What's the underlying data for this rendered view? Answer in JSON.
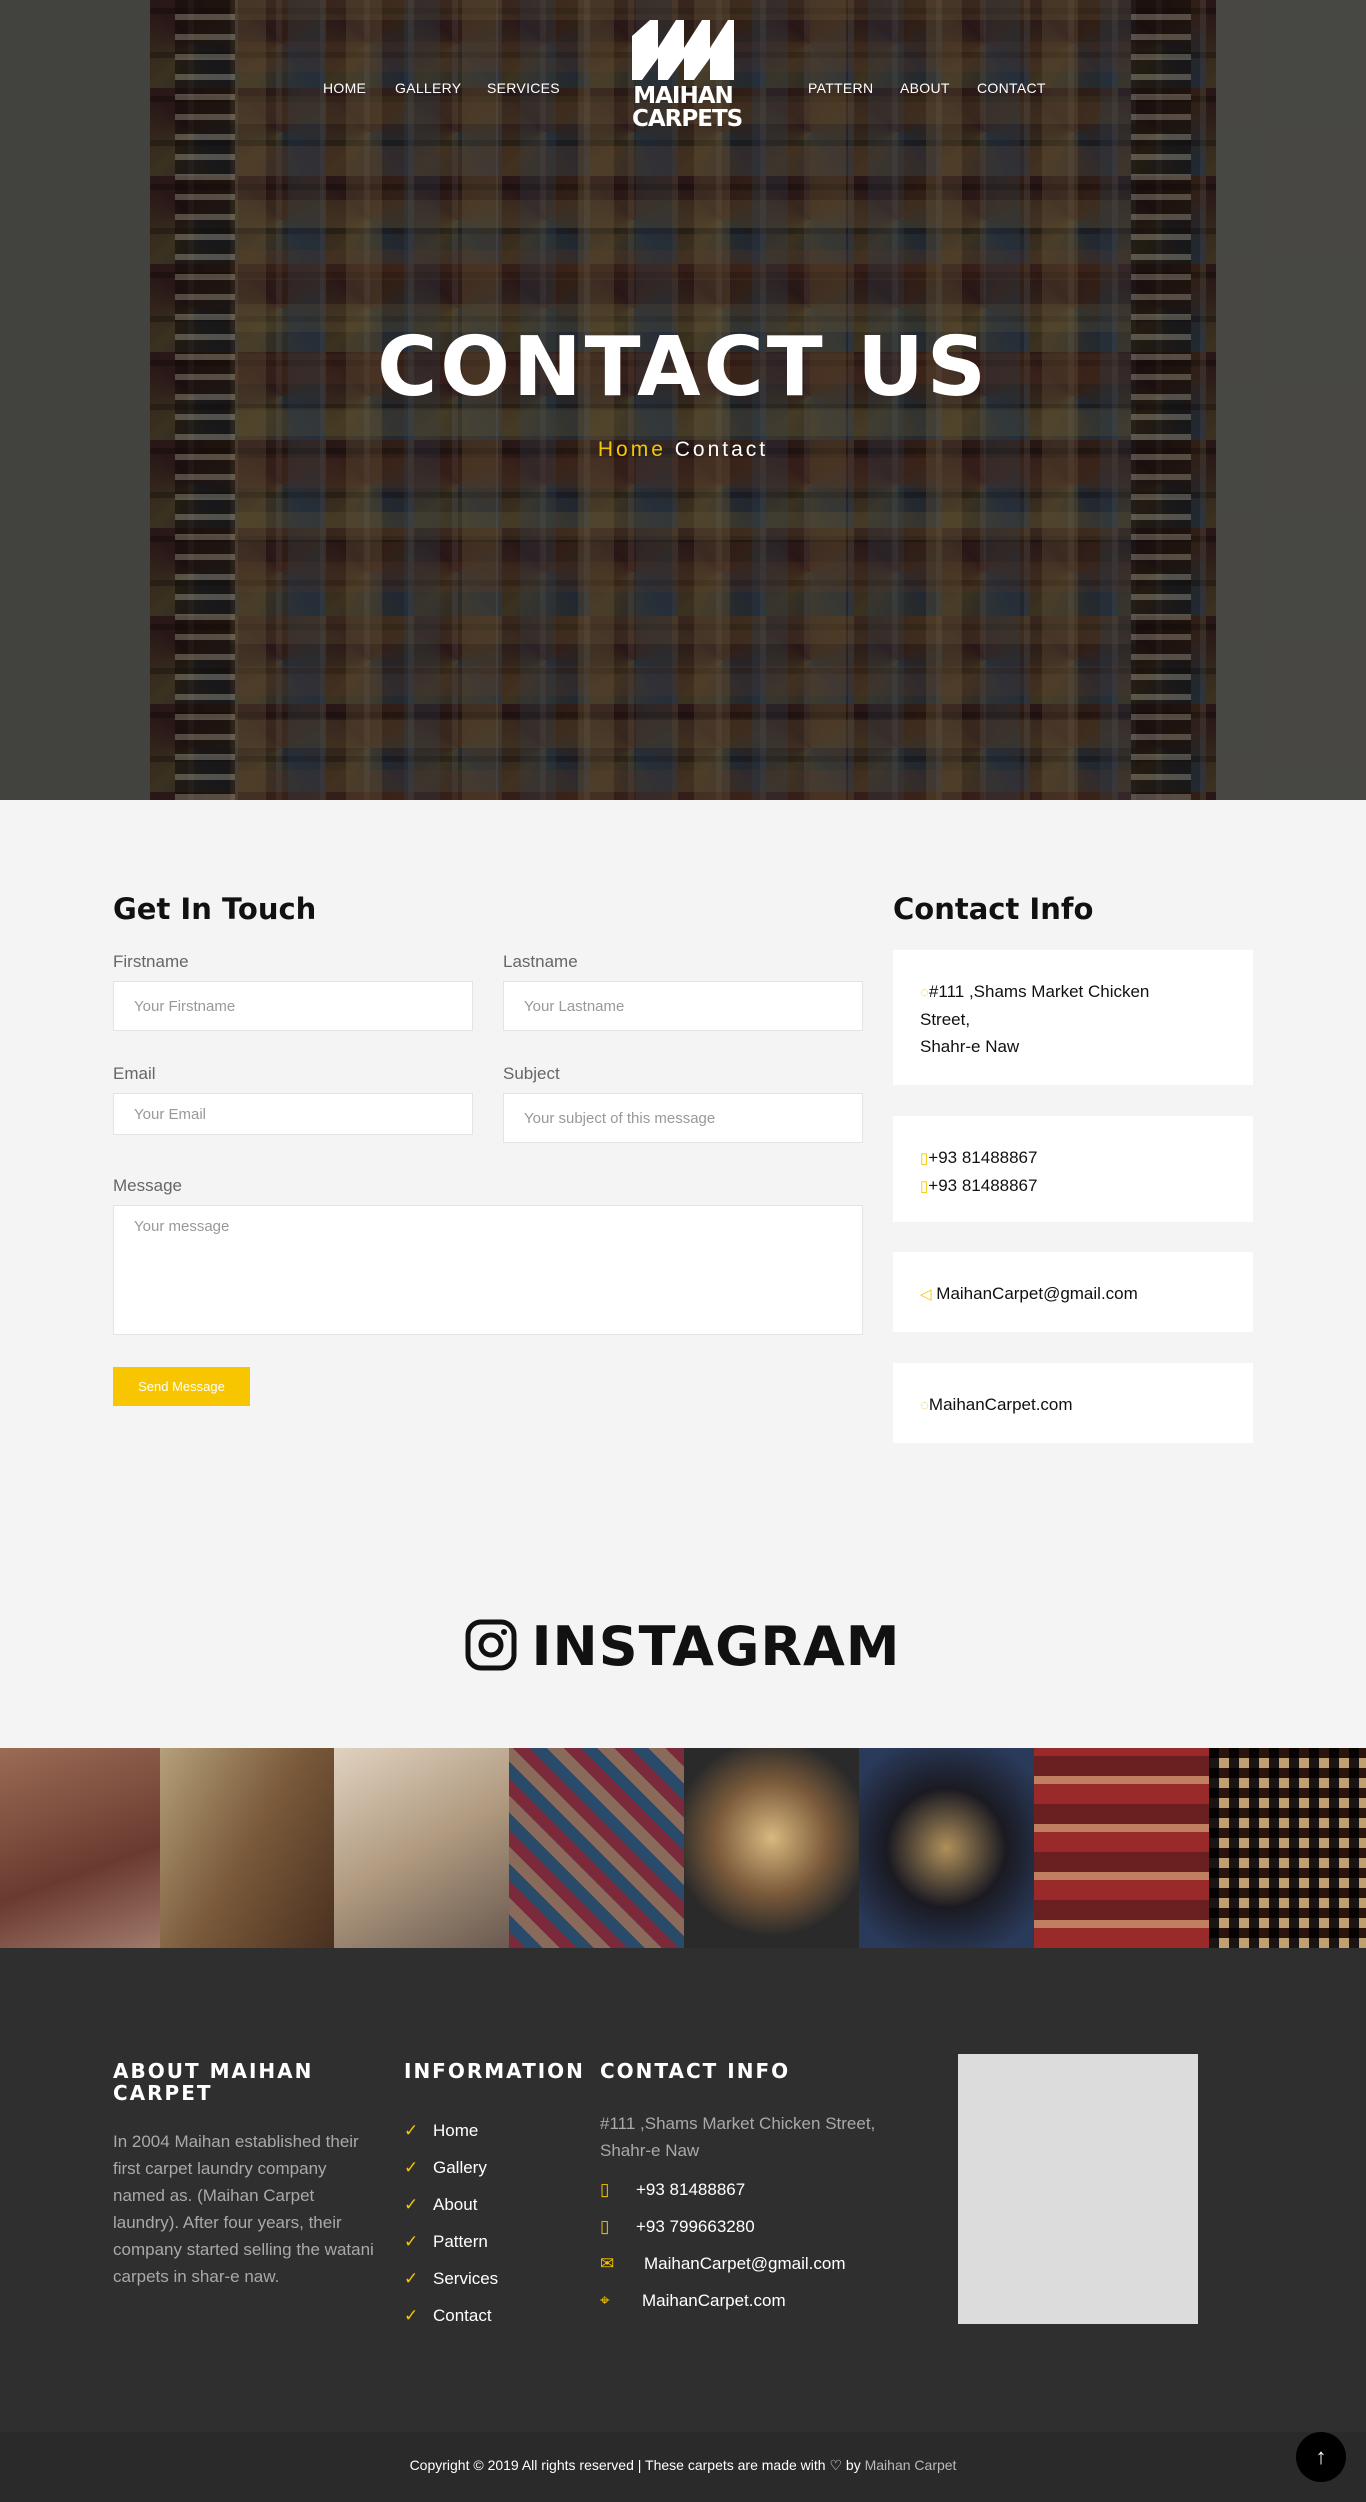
{
  "nav": {
    "left": [
      "HOME",
      "GALLERY",
      "SERVICES"
    ],
    "right": [
      "PATTERN",
      "ABOUT",
      "CONTACT"
    ],
    "logo_line1": "MAIHAN",
    "logo_line2": "CARPETS"
  },
  "hero": {
    "title": "CONTACT US",
    "crumb_home": "Home",
    "crumb_current": "Contact"
  },
  "form": {
    "title": "Get In Touch",
    "firstname_label": "Firstname",
    "firstname_placeholder": "Your Firstname",
    "lastname_label": "Lastname",
    "lastname_placeholder": "Your Lastname",
    "email_label": "Email",
    "email_placeholder": "Your Email",
    "subject_label": "Subject",
    "subject_placeholder": "Your subject of this message",
    "message_label": "Message",
    "message_placeholder": "Your message",
    "submit": "Send Message"
  },
  "info": {
    "title": "Contact Info",
    "address_line1": "#111 ,Shams Market Chicken",
    "address_line2": "Street,",
    "address_line3": "Shahr-e Naw",
    "phone1": "+93 81488867",
    "phone2": "+93 81488867",
    "email": "MaihanCarpet@gmail.com",
    "website": "MaihanCarpet.com"
  },
  "instagram": {
    "title": "INSTAGRAM",
    "photos": [
      "#7a4a3a",
      "#8a6a4a",
      "#b09a80",
      "#5a4a6a",
      "#6a5a4a",
      "#2a2a3a",
      "#8a3a2a",
      "#3a2a2a"
    ]
  },
  "footer": {
    "about_title": "ABOUT MAIHAN CARPET",
    "about_text": "In 2004 Maihan established their first carpet laundry company named as. (Maihan Carpet laundry). After four years, their company started selling the watani carpets in shar-e naw.",
    "info_title": "INFORMATION",
    "links": [
      "Home",
      "Gallery",
      "About",
      "Pattern",
      "Services",
      "Contact"
    ],
    "contact_title": "CONTACT INFO",
    "address": "#111 ,Shams Market Chicken Street, Shahr-e Naw",
    "phone1": "+93 81488867",
    "phone2": "+93 799663280",
    "email": "MaihanCarpet@gmail.com",
    "website": "MaihanCarpet.com"
  },
  "bottom": {
    "copyright": "Copyright © 2019 All rights reserved | These carpets are made with",
    "by": "by",
    "brand": "Maihan Carpet",
    "totop_icon": "arrow-up-icon"
  },
  "colors": {
    "accent": "#f7c600",
    "footer_bg": "#2f2f2f",
    "page_bg": "#f4f4f4"
  }
}
